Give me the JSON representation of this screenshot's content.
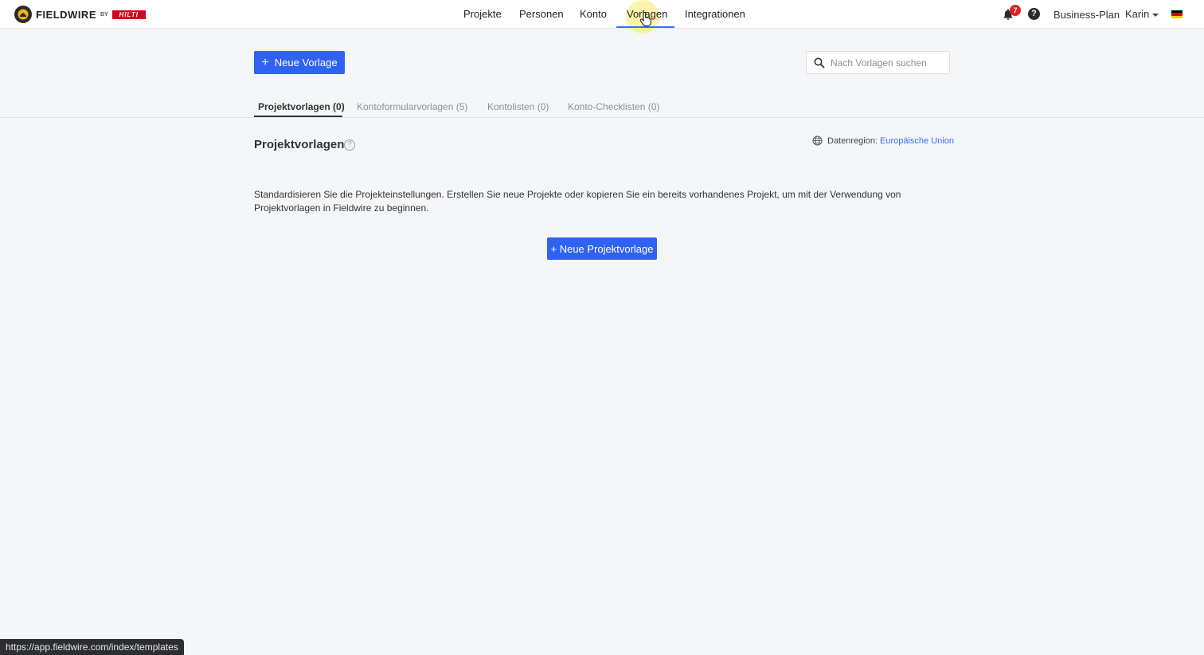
{
  "brand": {
    "name": "FIELDWIRE",
    "by": "BY",
    "partner": "HILTI"
  },
  "nav": {
    "items": [
      {
        "label": "Projekte"
      },
      {
        "label": "Personen"
      },
      {
        "label": "Konto"
      },
      {
        "label": "Vorlagen",
        "active": true
      },
      {
        "label": "Integrationen"
      }
    ]
  },
  "header": {
    "notification_count": "7",
    "help_glyph": "?",
    "plan": "Business-Plan",
    "user": "Karin",
    "flag_colors": [
      "#000000",
      "#dd0000",
      "#ffce00"
    ]
  },
  "toolbar": {
    "new_template_label": "Neue Vorlage",
    "plus_glyph": "+",
    "search_placeholder": "Nach Vorlagen suchen"
  },
  "tabs": [
    {
      "label": "Projektvorlagen (0)",
      "active": true
    },
    {
      "label": "Kontoformularvorlagen (5)"
    },
    {
      "label": "Kontolisten (0)"
    },
    {
      "label": "Konto-Checklisten (0)"
    }
  ],
  "section": {
    "title": "Projektvorlagen",
    "info_glyph": "?",
    "region_label": "Datenregion:",
    "region_value": "Europäische Union",
    "description": "Standardisieren Sie die Projekteinstellungen. Erstellen Sie neue Projekte oder kopieren Sie ein bereits vorhandenes Projekt, um mit der Verwendung von Projektvorlagen in Fieldwire zu beginnen.",
    "new_project_template_label": "+ Neue Projektvorlage"
  },
  "status_url": "https://app.fieldwire.com/index/templates",
  "colors": {
    "primary": "#2f62f0",
    "link": "#3d6ff5",
    "badge": "#e0231f",
    "background": "#f5f6f8"
  }
}
